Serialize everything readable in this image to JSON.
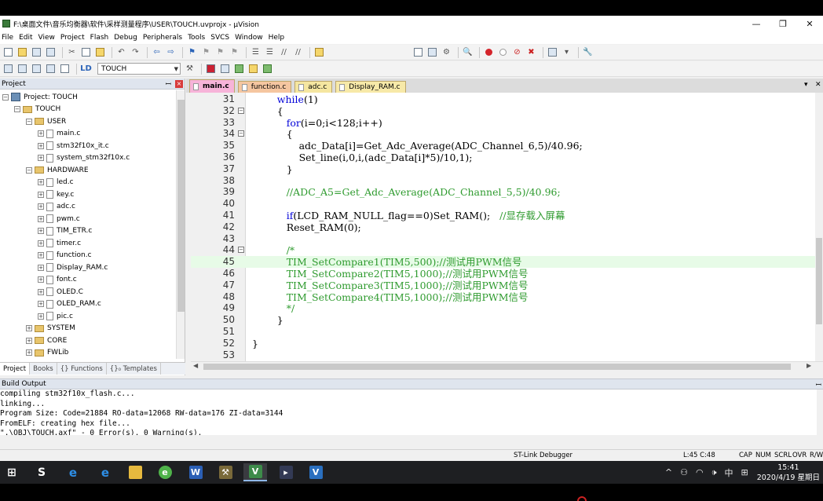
{
  "window": {
    "title": "F:\\桌面文件\\音乐均衡器\\软件\\采样测量程序\\USER\\TOUCH.uvprojx - µVision",
    "minimize_label": "—",
    "maximize_label": "❐",
    "close_label": "✕"
  },
  "menu": [
    "File",
    "Edit",
    "View",
    "Project",
    "Flash",
    "Debug",
    "Peripherals",
    "Tools",
    "SVCS",
    "Window",
    "Help"
  ],
  "toolbar": {
    "target": "TOUCH"
  },
  "project_panel": {
    "title": "Project",
    "pin": "ꟷ",
    "close": "×",
    "tree": [
      {
        "label": "Project: TOUCH",
        "level": 0,
        "type": "project",
        "exp": "−"
      },
      {
        "label": "TOUCH",
        "level": 1,
        "type": "folder",
        "exp": "−"
      },
      {
        "label": "USER",
        "level": 2,
        "type": "folder",
        "exp": "−"
      },
      {
        "label": "main.c",
        "level": 3,
        "type": "file",
        "exp": "+"
      },
      {
        "label": "stm32f10x_it.c",
        "level": 3,
        "type": "file",
        "exp": "+"
      },
      {
        "label": "system_stm32f10x.c",
        "level": 3,
        "type": "file",
        "exp": "+"
      },
      {
        "label": "HARDWARE",
        "level": 2,
        "type": "folder",
        "exp": "−"
      },
      {
        "label": "led.c",
        "level": 3,
        "type": "file",
        "exp": "+"
      },
      {
        "label": "key.c",
        "level": 3,
        "type": "file",
        "exp": "+"
      },
      {
        "label": "adc.c",
        "level": 3,
        "type": "file",
        "exp": "+"
      },
      {
        "label": "pwm.c",
        "level": 3,
        "type": "file",
        "exp": "+"
      },
      {
        "label": "TIM_ETR.c",
        "level": 3,
        "type": "file",
        "exp": "+"
      },
      {
        "label": "timer.c",
        "level": 3,
        "type": "file",
        "exp": "+"
      },
      {
        "label": "function.c",
        "level": 3,
        "type": "file",
        "exp": "+"
      },
      {
        "label": "Display_RAM.c",
        "level": 3,
        "type": "file",
        "exp": "+"
      },
      {
        "label": "font.c",
        "level": 3,
        "type": "file",
        "exp": "+"
      },
      {
        "label": "OLED.C",
        "level": 3,
        "type": "file",
        "exp": "+"
      },
      {
        "label": "OLED_RAM.c",
        "level": 3,
        "type": "file",
        "exp": "+"
      },
      {
        "label": "pic.c",
        "level": 3,
        "type": "file",
        "exp": "+"
      },
      {
        "label": "SYSTEM",
        "level": 2,
        "type": "folder",
        "exp": "+"
      },
      {
        "label": "CORE",
        "level": 2,
        "type": "folder",
        "exp": "+"
      },
      {
        "label": "FWLib",
        "level": 2,
        "type": "folder",
        "exp": "+"
      }
    ],
    "tabs": [
      "Project",
      "Books",
      "{} Functions",
      "{}₀ Templates"
    ]
  },
  "editor": {
    "tabs": [
      {
        "label": "main.c",
        "color": "#f7b4d9",
        "active": true
      },
      {
        "label": "function.c",
        "color": "#f5c6a0",
        "active": false
      },
      {
        "label": "adc.c",
        "color": "#f5e6a0",
        "active": false
      },
      {
        "label": "Display_RAM.c",
        "color": "#f7e9a8",
        "active": false
      }
    ],
    "tabs_menu": "▾",
    "tabs_close": "✕",
    "lines": [
      {
        "n": "31",
        "text": "        while(1)",
        "fold": ""
      },
      {
        "n": "32",
        "text": "        {",
        "fold": "−"
      },
      {
        "n": "33",
        "text": "           for(i=0;i<128;i++)",
        "fold": ""
      },
      {
        "n": "34",
        "text": "           {",
        "fold": "−"
      },
      {
        "n": "35",
        "text": "               adc_Data[i]=Get_Adc_Average(ADC_Channel_6,5)/40.96;",
        "fold": ""
      },
      {
        "n": "36",
        "text": "               Set_line(i,0,i,(adc_Data[i]*5)/10,1);",
        "fold": ""
      },
      {
        "n": "37",
        "text": "           }",
        "fold": ""
      },
      {
        "n": "38",
        "text": "",
        "fold": ""
      },
      {
        "n": "39",
        "text": "           //ADC_A5=Get_Adc_Average(ADC_Channel_5,5)/40.96;",
        "fold": ""
      },
      {
        "n": "40",
        "text": "",
        "fold": ""
      },
      {
        "n": "41",
        "text": "           if(LCD_RAM_NULL_flag==0)Set_RAM();   //显存载入屏幕",
        "fold": ""
      },
      {
        "n": "42",
        "text": "           Reset_RAM(0);",
        "fold": ""
      },
      {
        "n": "43",
        "text": "",
        "fold": ""
      },
      {
        "n": "44",
        "text": "           /*",
        "fold": "−"
      },
      {
        "n": "45",
        "text": "           TIM_SetCompare1(TIM5,500);//测试用PWM信号",
        "fold": ""
      },
      {
        "n": "46",
        "text": "           TIM_SetCompare2(TIM5,1000);//测试用PWM信号",
        "fold": ""
      },
      {
        "n": "47",
        "text": "           TIM_SetCompare3(TIM5,1000);//测试用PWM信号",
        "fold": ""
      },
      {
        "n": "48",
        "text": "           TIM_SetCompare4(TIM5,1000);//测试用PWM信号",
        "fold": ""
      },
      {
        "n": "49",
        "text": "           */",
        "fold": ""
      },
      {
        "n": "50",
        "text": "        }",
        "fold": ""
      },
      {
        "n": "51",
        "text": "",
        "fold": ""
      },
      {
        "n": "52",
        "text": "}",
        "fold": ""
      },
      {
        "n": "53",
        "text": "",
        "fold": ""
      }
    ],
    "current_line": "45"
  },
  "build_output": {
    "title": "Build Output",
    "pin": "ꟷ",
    "lines": [
      "compiling stm32f10x_flash.c...",
      "linking...",
      "Program Size: Code=21884 RO-data=12068 RW-data=176 ZI-data=3144",
      "FromELF: creating hex file...",
      "\".\\OBJ\\TOUCH.axf\" - 0 Error(s), 0 Warning(s)."
    ]
  },
  "status": {
    "debugger": "ST-Link Debugger",
    "position": "L:45 C:48",
    "caps": "CAP",
    "num": "NUM",
    "scrl": "SCRL",
    "ovr": "OVR",
    "rw": "R/W"
  },
  "taskbar": {
    "time": "15:41",
    "date": "2020/4/19 星期日",
    "ime": "中",
    "tray_up": "^",
    "volume": "🕩"
  }
}
